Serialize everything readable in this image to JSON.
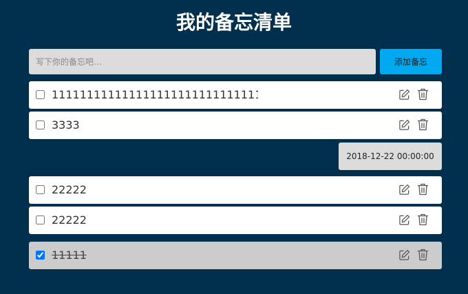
{
  "app": {
    "title": "我的备忘清单"
  },
  "input": {
    "placeholder": "写下你的备忘吧...",
    "value": "",
    "add_button_label": "添加备忘"
  },
  "memos": [
    {
      "text": "111111111111111111111111111111···",
      "checked": false
    },
    {
      "text": "3333",
      "checked": false
    },
    {
      "text": "22222",
      "checked": false
    },
    {
      "text": "22222",
      "checked": false
    },
    {
      "text": "11111",
      "checked": true
    }
  ],
  "date_badge": "2018-12-22 00:00:00",
  "icons": {
    "edit": "edit-icon",
    "delete": "trash-icon"
  },
  "colors": {
    "background": "#00304d",
    "accent": "#00a8f0",
    "item": "#ffffff",
    "item_done": "#cccccc",
    "input": "#dcdcdc"
  }
}
